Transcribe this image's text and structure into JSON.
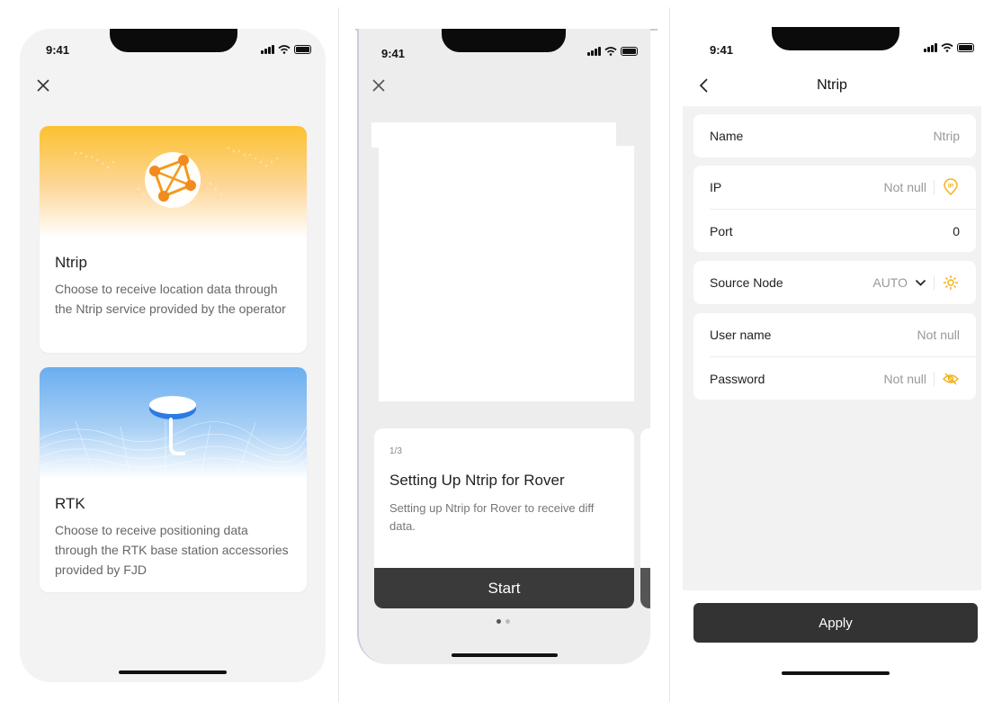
{
  "status_bar": {
    "time": "9:41"
  },
  "screen1": {
    "cards": [
      {
        "title": "Ntrip",
        "description": "Choose to receive location data through the Ntrip service provided by the operator",
        "banner_icon": "globe-network-icon"
      },
      {
        "title": "RTK",
        "description": "Choose to receive positioning data through the RTK base station accessories provided by FJD",
        "banner_icon": "gnss-antenna-icon"
      }
    ],
    "colors": {
      "ntrip_banner": "#fbb73a",
      "rtk_banner": "#7bb8ef",
      "background": "#f3f3f3"
    }
  },
  "screen2": {
    "step": "1/3",
    "title": "Setting Up Ntrip for Rover",
    "description": "Setting up Ntrip for Rover to receive diff data.",
    "start_label": "Start",
    "page_count": 2,
    "active_page": 1
  },
  "screen3": {
    "title": "Ntrip",
    "fields": {
      "name": {
        "label": "Name",
        "value": "Ntrip"
      },
      "ip": {
        "label": "IP",
        "value": "Not null"
      },
      "port": {
        "label": "Port",
        "value": "0"
      },
      "source_node": {
        "label": "Source Node",
        "value": "AUTO"
      },
      "user_name": {
        "label": "User name",
        "value": "Not null"
      },
      "password": {
        "label": "Password",
        "value": "Not null"
      }
    },
    "apply_label": "Apply",
    "colors": {
      "accent": "#f2b21b",
      "button": "#333333"
    }
  }
}
